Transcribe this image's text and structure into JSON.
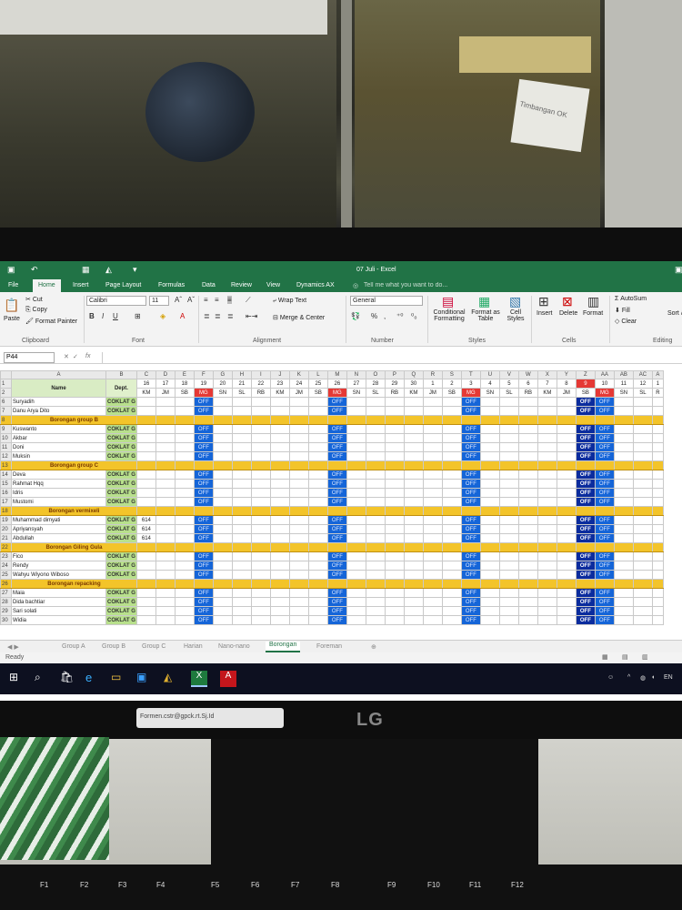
{
  "window": {
    "title": "07 Juli - Excel"
  },
  "tabs": [
    "File",
    "Home",
    "Insert",
    "Page Layout",
    "Formulas",
    "Data",
    "Review",
    "View",
    "Dynamics AX"
  ],
  "tell_me": "Tell me what you want to do...",
  "ribbon": {
    "clipboard": {
      "paste": "Paste",
      "cut": "Cut",
      "copy": "Copy",
      "format_painter": "Format Painter",
      "group": "Clipboard"
    },
    "font": {
      "name": "Calibri",
      "size": "11",
      "group": "Font"
    },
    "alignment": {
      "wrap": "Wrap Text",
      "merge": "Merge & Center",
      "group": "Alignment"
    },
    "number": {
      "format": "General",
      "group": "Number"
    },
    "styles": {
      "conditional": "Conditional Formatting",
      "format_table": "Format as Table",
      "cell_styles": "Cell Styles",
      "group": "Styles"
    },
    "cells": {
      "insert": "Insert",
      "delete": "Delete",
      "format": "Format",
      "group": "Cells"
    },
    "editing": {
      "autosum": "AutoSum",
      "fill": "Fill",
      "clear": "Clear",
      "sort": "Sort & Filter",
      "group": "Editing"
    }
  },
  "formula_bar": {
    "name_box": "P44",
    "fx": "fx"
  },
  "grid": {
    "columns": [
      "A",
      "B",
      "C",
      "D",
      "E",
      "F",
      "G",
      "H",
      "I",
      "J",
      "K",
      "L",
      "M",
      "N",
      "O",
      "P",
      "Q",
      "R",
      "S",
      "T",
      "U",
      "V",
      "W",
      "X",
      "Y",
      "Z",
      "AA",
      "AB",
      "AC",
      "A"
    ],
    "header_row1": [
      "",
      "",
      "16",
      "17",
      "18",
      "19",
      "20",
      "21",
      "22",
      "23",
      "24",
      "25",
      "26",
      "27",
      "28",
      "29",
      "30",
      "1",
      "2",
      "3",
      "4",
      "5",
      "6",
      "7",
      "8",
      "9",
      "10",
      "11",
      "12",
      "1"
    ],
    "header_row2": [
      "Name",
      "Dept.",
      "KM",
      "JM",
      "SB",
      "MG",
      "SN",
      "SL",
      "RB",
      "KM",
      "JM",
      "SB",
      "MG",
      "SN",
      "SL",
      "RB",
      "KM",
      "JM",
      "SB",
      "MG",
      "SN",
      "SL",
      "RB",
      "KM",
      "JM",
      "SB",
      "MG",
      "SN",
      "SL",
      "R"
    ],
    "rows": [
      {
        "r": "6",
        "name": "Suryadih",
        "dept": "COKLAT G",
        "type": "emp",
        "c": ""
      },
      {
        "r": "7",
        "name": "Danu Arya Dito",
        "dept": "COKLAT G",
        "type": "emp",
        "c": ""
      },
      {
        "r": "8",
        "name": "Borongan group B",
        "type": "group"
      },
      {
        "r": "9",
        "name": "Kuswanto",
        "dept": "COKLAT G",
        "type": "emp",
        "c": ""
      },
      {
        "r": "10",
        "name": "Akbar",
        "dept": "COKLAT G",
        "type": "emp",
        "c": ""
      },
      {
        "r": "11",
        "name": "Doni",
        "dept": "COKLAT G",
        "type": "emp",
        "c": ""
      },
      {
        "r": "12",
        "name": "Muksin",
        "dept": "COKLAT G",
        "type": "emp",
        "c": ""
      },
      {
        "r": "13",
        "name": "Borongan group C",
        "type": "group"
      },
      {
        "r": "14",
        "name": "Deva",
        "dept": "COKLAT G",
        "type": "emp",
        "c": ""
      },
      {
        "r": "15",
        "name": "Rahmat Hqq",
        "dept": "COKLAT G",
        "type": "emp",
        "c": ""
      },
      {
        "r": "16",
        "name": "Idris",
        "dept": "COKLAT G",
        "type": "emp",
        "c": ""
      },
      {
        "r": "17",
        "name": "Mustomi",
        "dept": "COKLAT G",
        "type": "emp",
        "c": ""
      },
      {
        "r": "18",
        "name": "Borongan vermixeli",
        "type": "group"
      },
      {
        "r": "19",
        "name": "Muhammad dimyati",
        "dept": "COKLAT G",
        "type": "emp",
        "c": "614"
      },
      {
        "r": "20",
        "name": "Apriyansyah",
        "dept": "COKLAT G",
        "type": "emp",
        "c": "614"
      },
      {
        "r": "21",
        "name": "Abdullah",
        "dept": "COKLAT G",
        "type": "emp",
        "c": "614"
      },
      {
        "r": "22",
        "name": "Borongan Giling Gula",
        "type": "group"
      },
      {
        "r": "23",
        "name": "Fico",
        "dept": "COKLAT G",
        "type": "emp",
        "c": ""
      },
      {
        "r": "24",
        "name": "Rendy",
        "dept": "COKLAT G",
        "type": "emp",
        "c": ""
      },
      {
        "r": "25",
        "name": "Wahyu Wiyono Wiboso",
        "dept": "COKLAT G",
        "type": "emp",
        "c": ""
      },
      {
        "r": "26",
        "name": "Borongan repacking",
        "type": "group"
      },
      {
        "r": "27",
        "name": "Maia",
        "dept": "COKLAT G",
        "type": "emp",
        "c": ""
      },
      {
        "r": "28",
        "name": "Dida bachtiar",
        "dept": "COKLAT G",
        "type": "emp",
        "c": ""
      },
      {
        "r": "29",
        "name": "Sari solati",
        "dept": "COKLAT G",
        "type": "emp",
        "c": ""
      },
      {
        "r": "30",
        "name": "Widia",
        "dept": "COKLAT G",
        "type": "emp",
        "c": ""
      }
    ],
    "off_label": "OFF"
  },
  "sheet_tabs": [
    "Group A",
    "Group B",
    "Group C",
    "Harian",
    "Nano-nano",
    "Borongan",
    "Foreman"
  ],
  "active_sheet": "Borongan",
  "status": "Ready",
  "monitor_brand": "LG",
  "monitor_sticker": "Formen.cstr@gpck.rt.Sj.Id",
  "note_text": "Timbangan OK",
  "fkeys": [
    "F1",
    "F2",
    "F3",
    "F4",
    "F5",
    "F6",
    "F7",
    "F8",
    "F9",
    "F10",
    "F11",
    "F12"
  ],
  "colors": {
    "excel_green": "#217346",
    "mg_red": "#e53935",
    "off_blue": "#1565d8",
    "off_navy": "#0b2c9e",
    "group_yellow": "#f3c42a",
    "dept_green": "#b8e08c"
  }
}
